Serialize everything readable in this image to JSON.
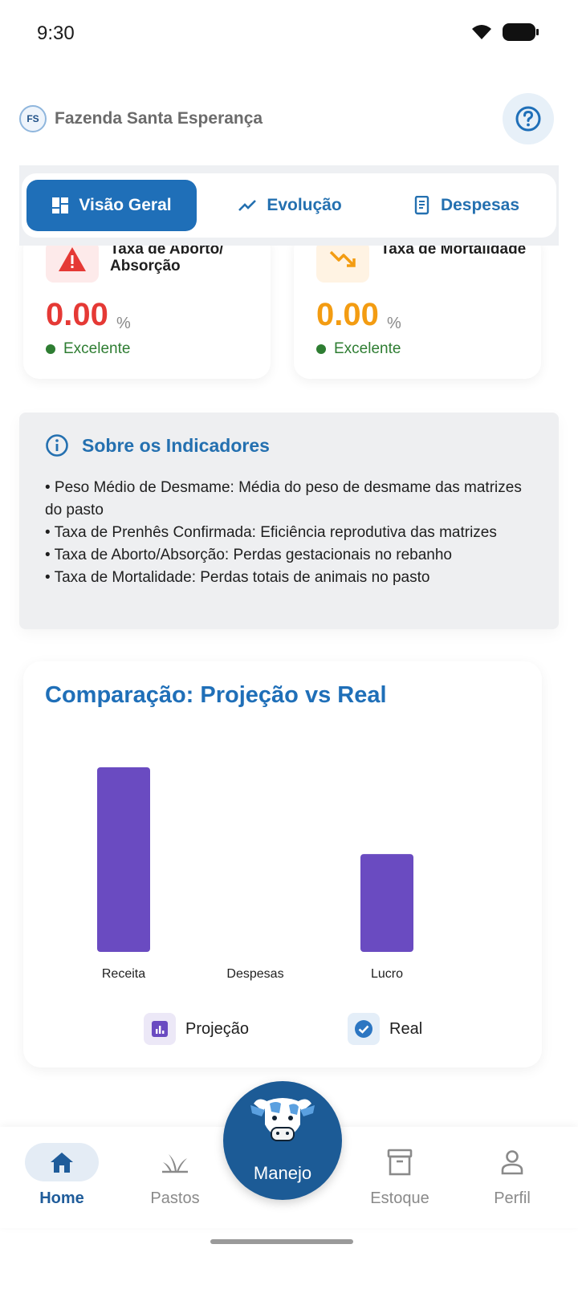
{
  "status_bar": {
    "time": "9:30"
  },
  "header": {
    "farm_initials": "FS",
    "farm_name": "Fazenda Santa Esperança"
  },
  "tabs": [
    {
      "label": "Visão Geral",
      "icon": "dashboard-icon",
      "active": true
    },
    {
      "label": "Evolução",
      "icon": "trend-line-icon",
      "active": false
    },
    {
      "label": "Despesas",
      "icon": "receipt-icon",
      "active": false
    }
  ],
  "metrics": [
    {
      "title": "Taxa de Aborto/ Absorção",
      "value": "0.00",
      "unit": "%",
      "status": "Excelente",
      "icon": "warning-icon",
      "color": "#e53935"
    },
    {
      "title": "Taxa de Mortalidade",
      "value": "0.00",
      "unit": "%",
      "status": "Excelente",
      "icon": "trending-down-icon",
      "color": "#f39c12"
    }
  ],
  "info": {
    "title": "Sobre os Indicadores",
    "items": [
      "• Peso Médio de Desmame: Média do peso de desmame das matrizes do pasto",
      "• Taxa de Prenhês Confirmada: Eficiência reprodutiva das matrizes",
      "• Taxa de Aborto/Absorção: Perdas gestacionais no rebanho",
      "• Taxa de Mortalidade: Perdas totais de animais no pasto"
    ]
  },
  "chart_data": {
    "type": "bar",
    "title": "Comparação: Projeção vs Real",
    "categories": [
      "Receita",
      "Despesas",
      "Lucro"
    ],
    "series": [
      {
        "name": "Projeção",
        "values": [
          1.0,
          0.0,
          0.53
        ],
        "color": "#6a4bc1"
      },
      {
        "name": "Real",
        "values": [
          0,
          0,
          0
        ],
        "color": "#2c76c2"
      }
    ],
    "ylim": [
      0,
      1.0
    ]
  },
  "bottom_nav": {
    "items": [
      {
        "label": "Home",
        "icon": "home-icon",
        "active": true
      },
      {
        "label": "Pastos",
        "icon": "grass-icon",
        "active": false
      },
      {
        "label": "Estoque",
        "icon": "archive-box-icon",
        "active": false
      },
      {
        "label": "Perfil",
        "icon": "person-icon",
        "active": false
      }
    ],
    "center_label": "Manejo",
    "center_icon": "cow-icon"
  }
}
